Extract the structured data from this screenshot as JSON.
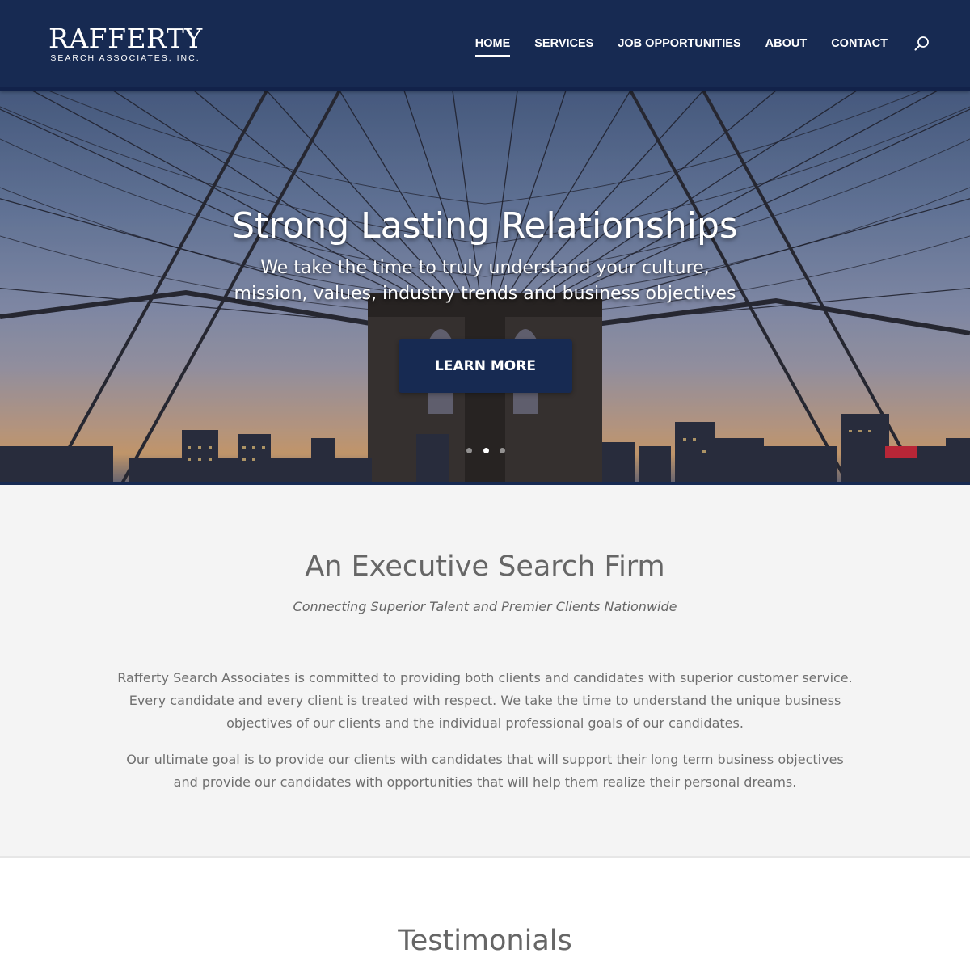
{
  "header": {
    "logo_main": "RAFFERTY",
    "logo_sub": "SEARCH ASSOCIATES, INC.",
    "nav": [
      {
        "label": "HOME",
        "active": true
      },
      {
        "label": "SERVICES",
        "active": false
      },
      {
        "label": "JOB OPPORTUNITIES",
        "active": false
      },
      {
        "label": "ABOUT",
        "active": false
      },
      {
        "label": "CONTACT",
        "active": false
      }
    ],
    "search_icon": "search-icon"
  },
  "hero": {
    "title": "Strong Lasting Relationships",
    "subtitle": "We take the time to truly understand your culture, mission, values, industry trends and business objectives",
    "button_label": "LEARN MORE",
    "slides": 3,
    "active_slide": 2
  },
  "about": {
    "title": "An Executive Search Firm",
    "tagline": "Connecting Superior Talent and Premier Clients Nationwide",
    "paragraph_1": "Rafferty Search Associates is committed to providing both clients and candidates with superior customer service. Every candidate and every client is treated with respect. We take the time to understand the unique business objectives of our clients and the individual professional goals of our candidates.",
    "paragraph_2": "Our ultimate goal is to provide our clients with candidates that will support their long term business objectives and provide our candidates with opportunities that will help them realize their personal dreams."
  },
  "testimonials": {
    "title": "Testimonials"
  },
  "colors": {
    "brand_navy": "#172a52",
    "section_gray": "#f4f4f4",
    "text_gray": "#666666"
  }
}
